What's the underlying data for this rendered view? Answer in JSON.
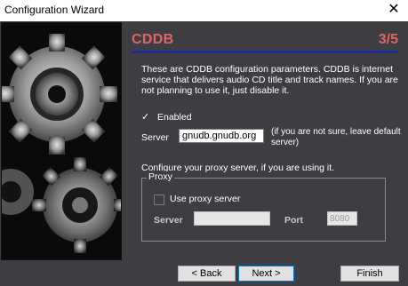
{
  "window": {
    "title": "Configuration Wizard",
    "close_icon": "close-icon"
  },
  "header": {
    "title": "CDDB",
    "step": "3/5"
  },
  "description": "These are CDDB configuration parameters. CDDB is internet service that delivers audio CD title and track names. If you are not planning to use it, just disable it.",
  "enabled": {
    "label": "Enabled",
    "checked": true
  },
  "server": {
    "label": "Server",
    "value": "gnudb.gnudb.org",
    "hint": "(if you are not sure, leave default server)"
  },
  "proxy_intro": "Configure your proxy server, if you are using it.",
  "proxy": {
    "group_label": "Proxy",
    "use_label": "Use proxy server",
    "use_checked": false,
    "server_label": "Server",
    "server_value": "",
    "port_label": "Port",
    "port_value": "8080"
  },
  "buttons": {
    "back": "Back",
    "next": "Next",
    "finish": "Finish"
  },
  "colors": {
    "accent": "#e06666",
    "header_line": "#1c2a9c",
    "background": "#3e3e42"
  }
}
